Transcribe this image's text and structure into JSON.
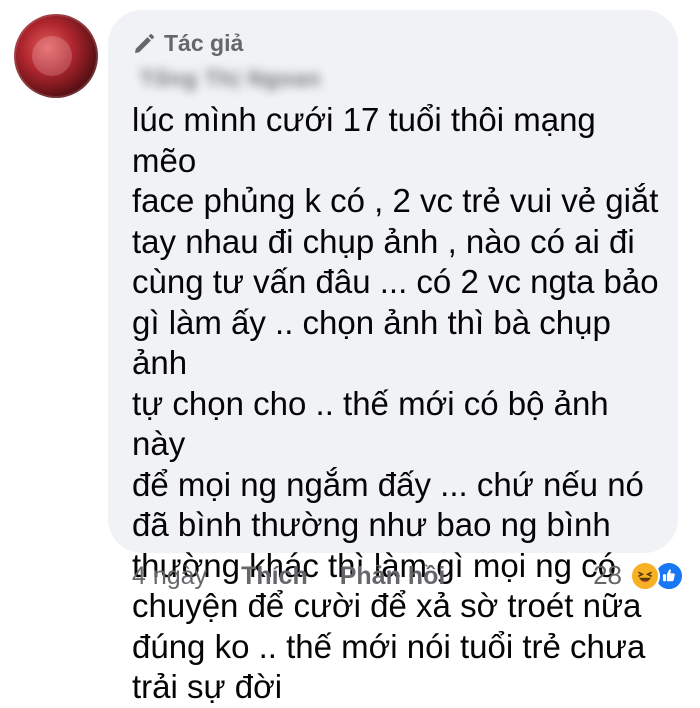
{
  "author": {
    "badge_label": "Tác giả",
    "badge_icon": "pen-icon",
    "name": "Tống Thị Ngoan"
  },
  "comment": {
    "text": "lúc mình cưới 17 tuổi thôi mạng mẽo\nface phủng k có , 2 vc trẻ vui vẻ giắt\ntay nhau đi chụp ảnh , nào có ai đi\ncùng tư vấn đâu ...  có 2 vc ngta bảo\ngì làm ấy .. chọn ảnh thì bà chụp ảnh\ntự chọn cho .. thế mới có bộ ảnh này\nđể mọi ng ngắm đấy ... chứ nếu nó\nđã bình thường như bao ng bình\nthường khác thì làm gì mọi ng có\nchuyện để cười để xả sờ troét nữa\nđúng ko .. thế mới nói tuổi trẻ chưa\ntrải sự đời"
  },
  "actions": {
    "time": "4 ngày",
    "like_label": "Thích",
    "reply_label": "Phản hồi"
  },
  "reactions": {
    "count": "28",
    "types": [
      "haha-icon",
      "like-icon"
    ]
  },
  "colors": {
    "bubble": "#f0f2f5",
    "secondary_text": "#65676b",
    "primary_text": "#050505",
    "haha": "#f7b125",
    "like": "#1877f2"
  }
}
